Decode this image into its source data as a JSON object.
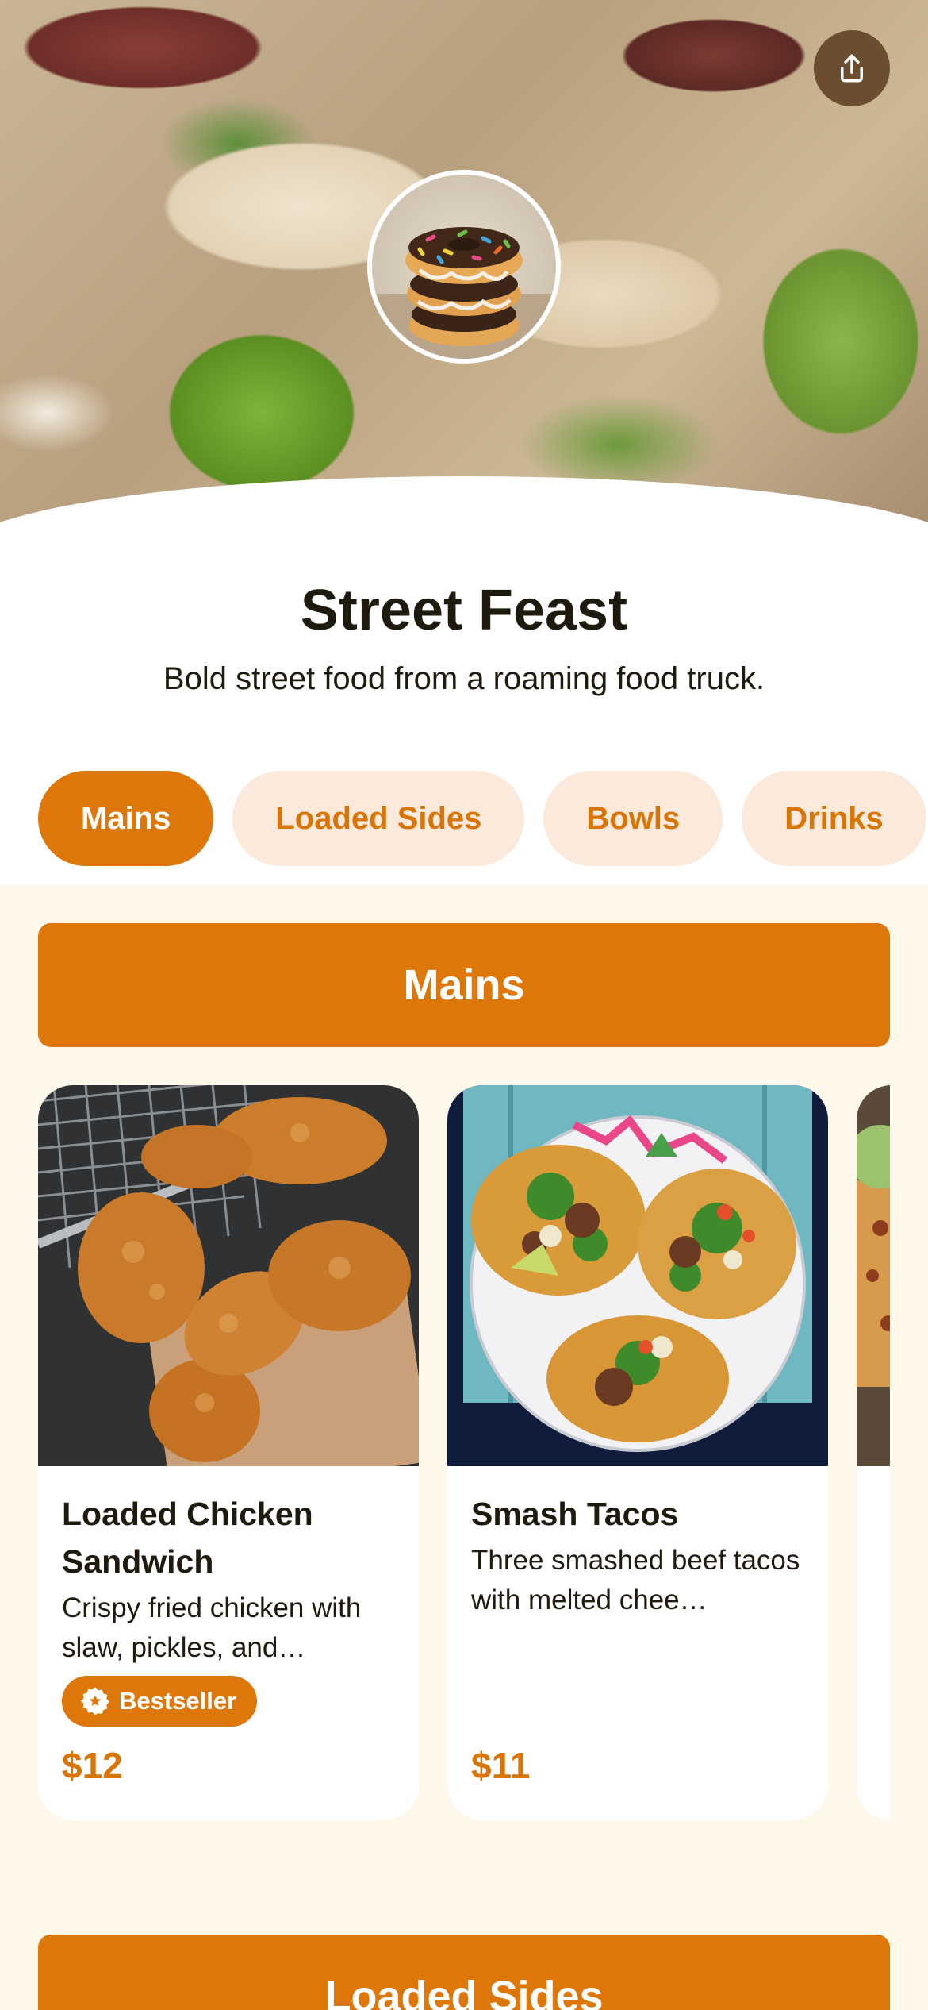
{
  "restaurant": {
    "name": "Street Feast",
    "tagline": "Bold street food from a roaming food truck."
  },
  "tabs": [
    {
      "label": "Mains",
      "active": true
    },
    {
      "label": "Loaded Sides",
      "active": false
    },
    {
      "label": "Bowls",
      "active": false
    },
    {
      "label": "Drinks",
      "active": false
    }
  ],
  "sections": [
    {
      "title": "Mains",
      "items": [
        {
          "name": "Loaded Chicken Sandwich",
          "description": "Crispy fried chicken with slaw, pickles, and…",
          "badge": "Bestseller",
          "price": "$12",
          "image": "fried-chicken"
        },
        {
          "name": "Smash Tacos",
          "description": "Three smashed beef tacos with melted chee…",
          "price": "$11",
          "image": "tacos"
        },
        {
          "name": "",
          "description": "",
          "price": "",
          "image": "quesadilla"
        }
      ]
    },
    {
      "title": "Loaded Sides"
    }
  ],
  "icons": {
    "share": "share-icon",
    "badge": "star-badge-icon"
  },
  "colors": {
    "accent": "#de770a",
    "accent_soft": "#fbeadb",
    "background": "#fdf8ea"
  }
}
